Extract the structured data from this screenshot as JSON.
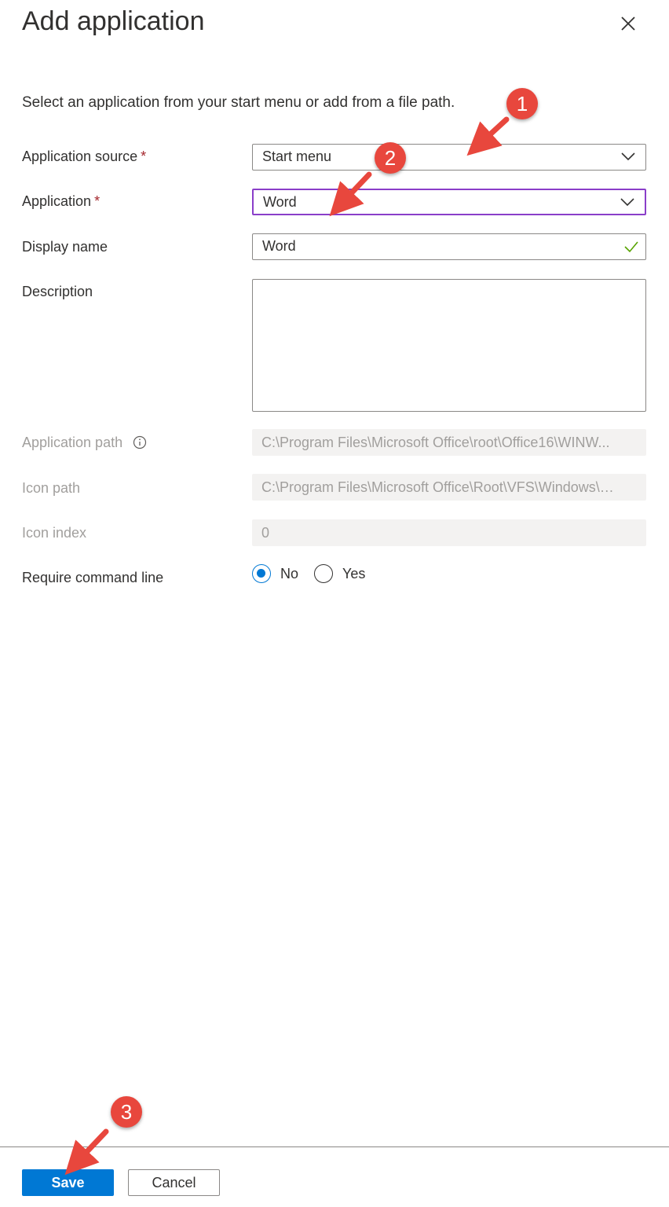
{
  "panel": {
    "title": "Add application",
    "intro": "Select an application from your start menu or add from a file path."
  },
  "form": {
    "source": {
      "label": "Application source",
      "required_mark": "*",
      "value": "Start menu"
    },
    "application": {
      "label": "Application",
      "required_mark": "*",
      "value": "Word"
    },
    "display_name": {
      "label": "Display name",
      "value": "Word"
    },
    "description": {
      "label": "Description",
      "value": ""
    },
    "app_path": {
      "label": "Application path",
      "value": "C:\\Program Files\\Microsoft Office\\root\\Office16\\WINW..."
    },
    "icon_path": {
      "label": "Icon path",
      "value": "C:\\Program Files\\Microsoft Office\\Root\\VFS\\Windows\\I..."
    },
    "icon_index": {
      "label": "Icon index",
      "value": "0"
    },
    "require_cmd": {
      "label": "Require command line",
      "options": [
        "No",
        "Yes"
      ],
      "selected": "No"
    }
  },
  "footer": {
    "save_label": "Save",
    "cancel_label": "Cancel"
  },
  "annotations": [
    "1",
    "2",
    "3"
  ],
  "colors": {
    "primary": "#0078d4",
    "focus": "#8a3ec9",
    "required": "#a4262c",
    "badge": "#e8473d",
    "valid": "#57a300"
  },
  "icons": {
    "close": "close-icon",
    "chevron": "chevron-down-icon",
    "check": "checkmark-icon",
    "info": "info-icon"
  }
}
